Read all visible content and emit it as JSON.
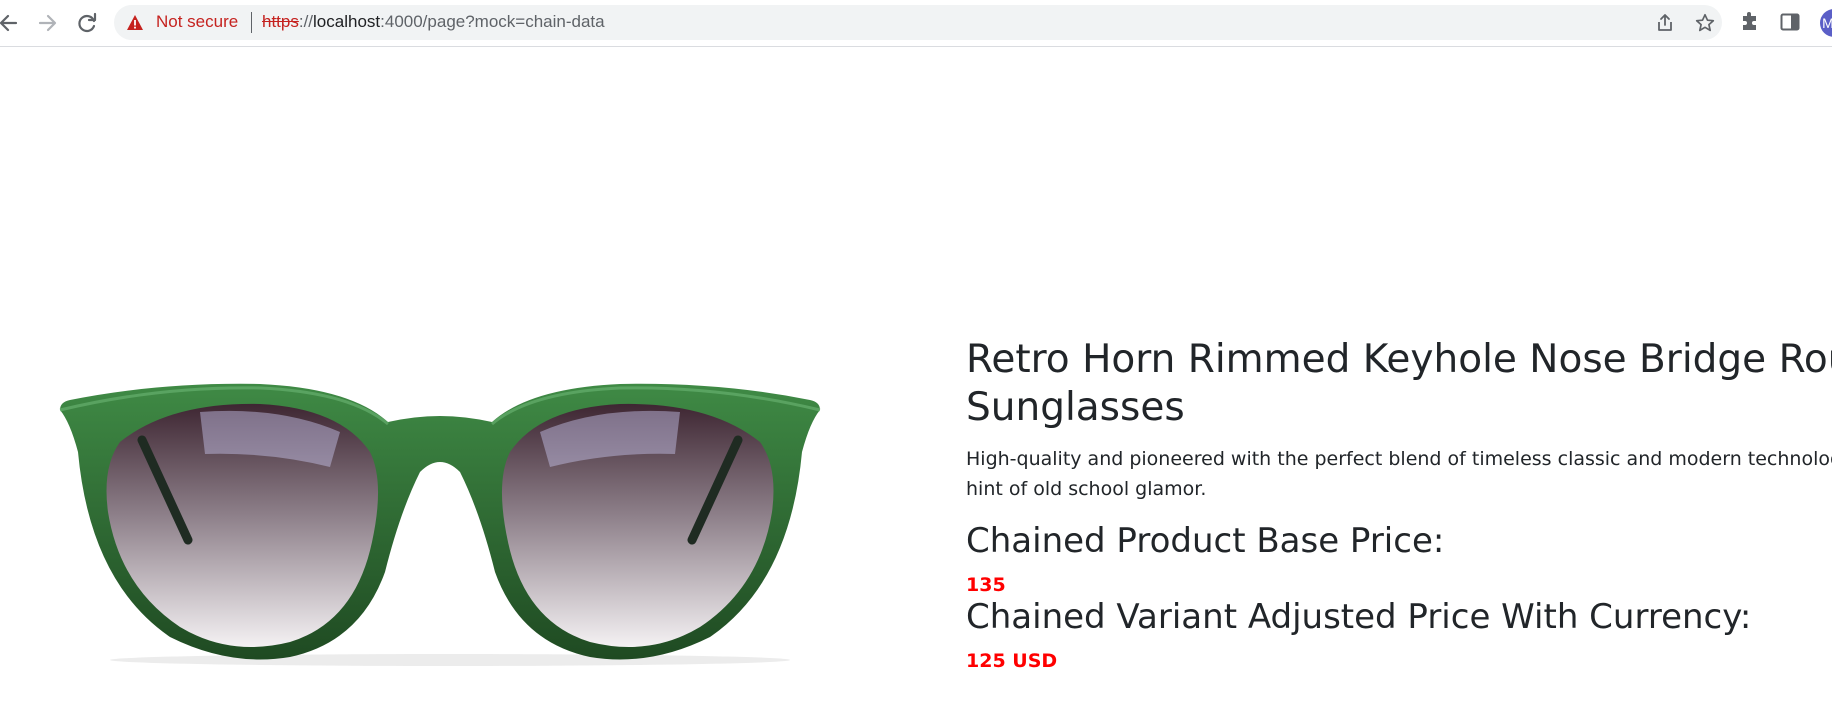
{
  "browser": {
    "security_label": "Not secure",
    "url_scheme": "https",
    "url_separator": "://",
    "url_host": "localhost",
    "url_rest": ":4000/page?mock=chain-data",
    "avatar_initial": "M",
    "icons": [
      "back-arrow-icon",
      "forward-arrow-icon",
      "reload-icon",
      "warning-icon",
      "share-icon",
      "star-icon",
      "extensions-icon",
      "side-panel-icon"
    ]
  },
  "product": {
    "image": "sunglasses-image",
    "title_line1": "Retro Horn Rimmed Keyhole Nose Bridge Round",
    "title_line2": "Sunglasses",
    "description_line1": "High-quality and pioneered with the perfect blend of timeless classic and modern technology with",
    "description_line2": "hint of old school glamor.",
    "base_price_heading": "Chained Product Base Price:",
    "base_price": "135",
    "variant_price_heading": "Chained Variant Adjusted Price With Currency:",
    "variant_price": "125 USD"
  },
  "colors": {
    "price": "#ff0000",
    "frame": "#2f6b32",
    "warning": "#c5221f",
    "avatar": "#5b5fc7"
  }
}
